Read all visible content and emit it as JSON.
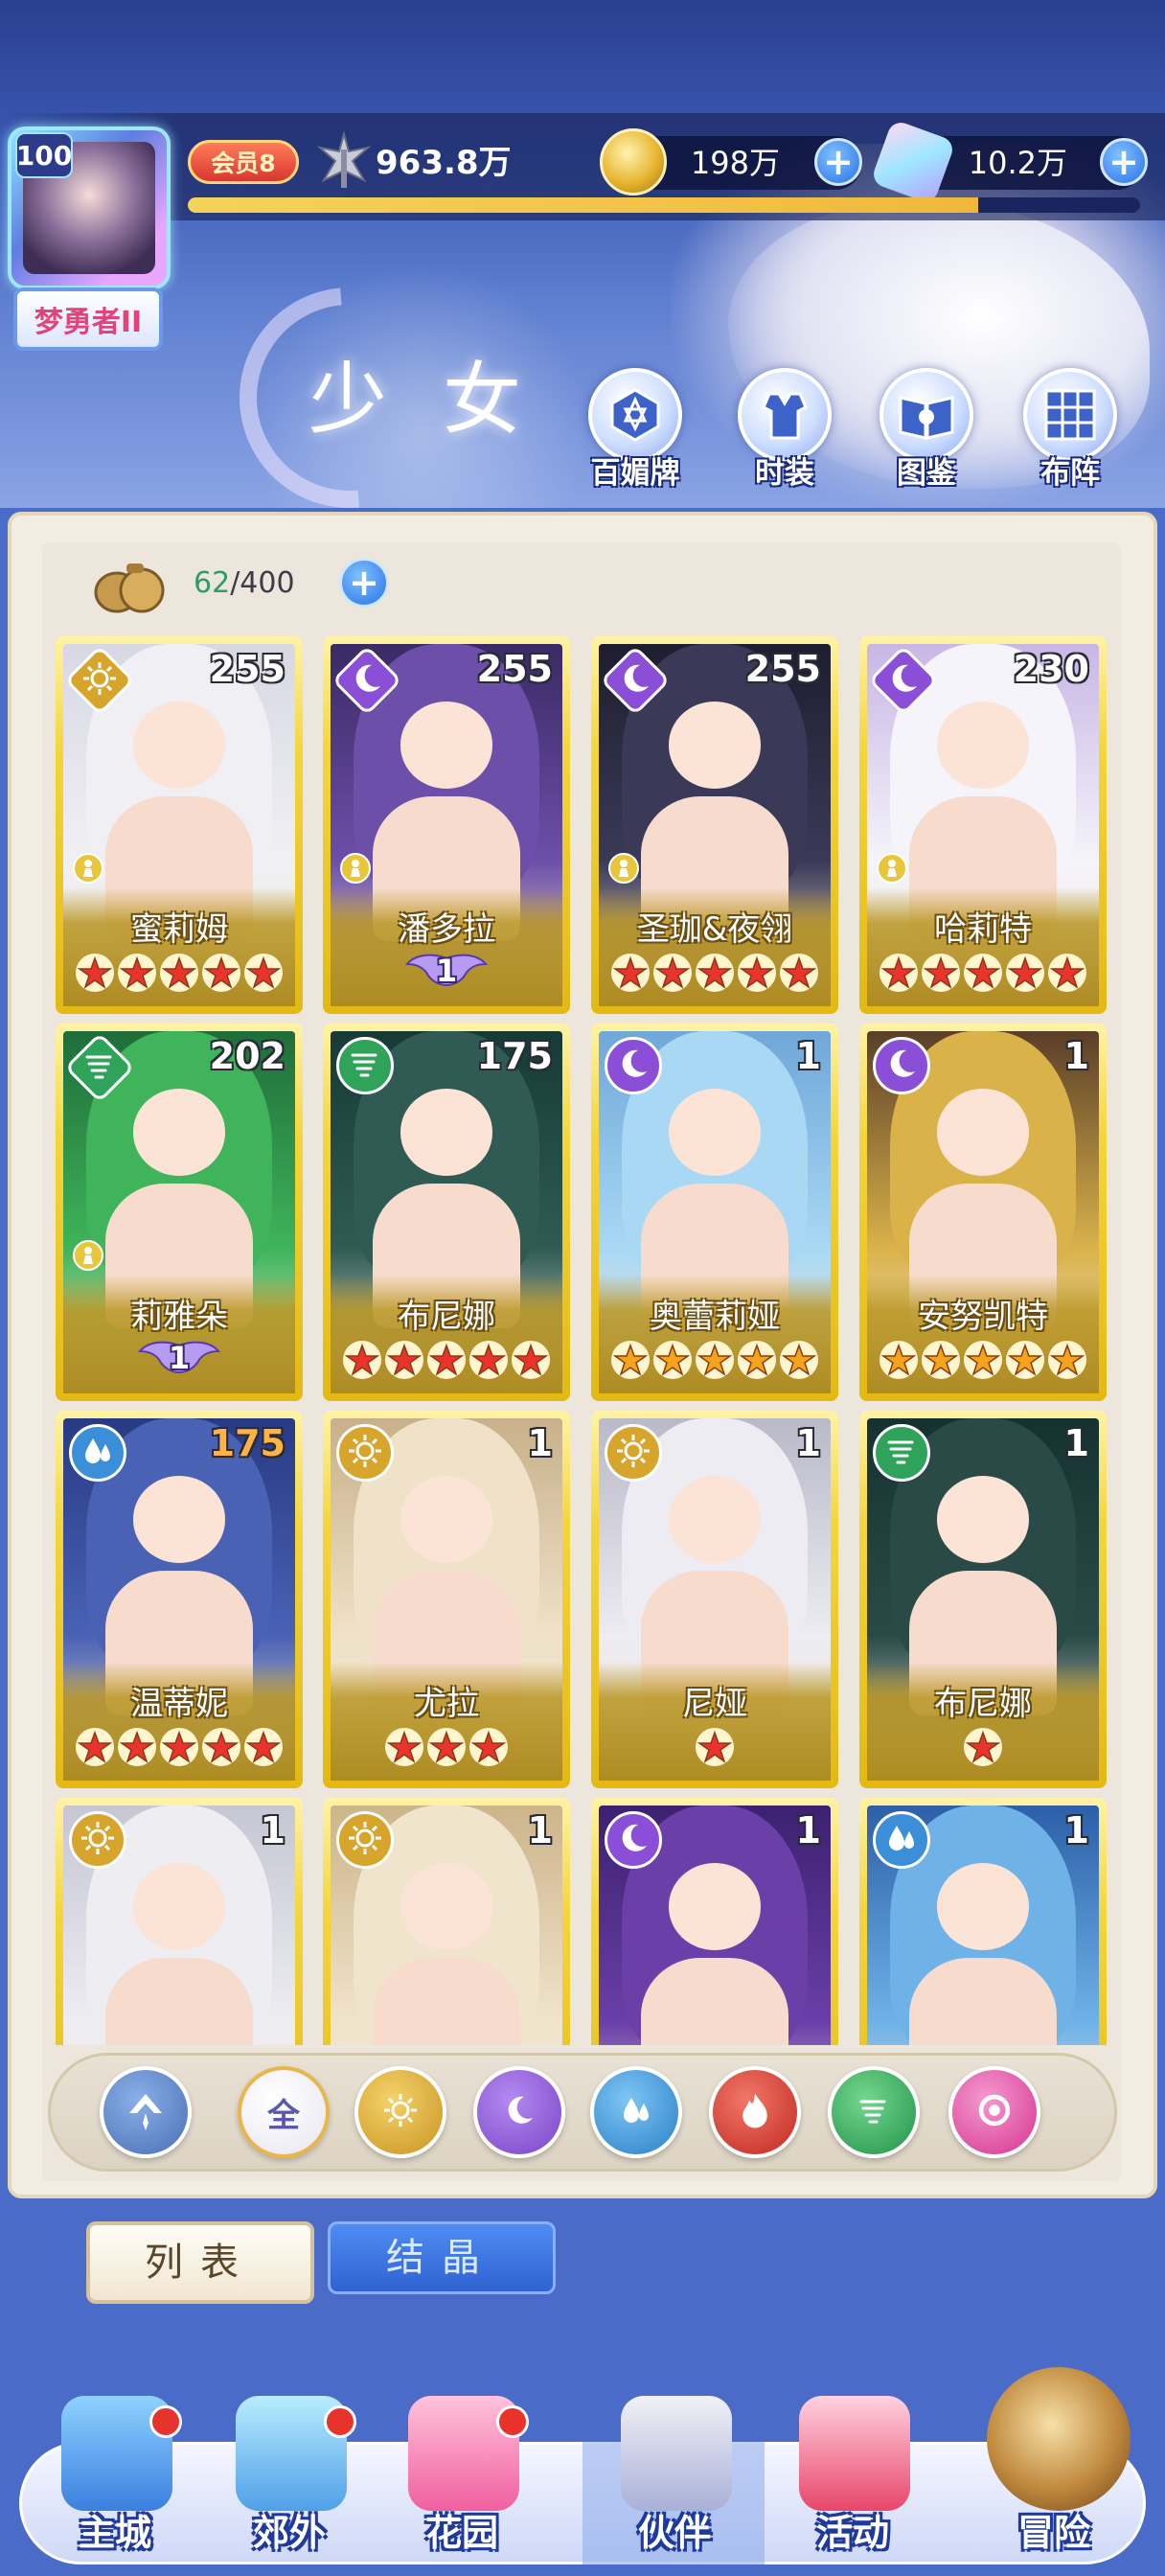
{
  "player": {
    "level": "100",
    "title": "梦勇者II",
    "vip": "会员8",
    "power": "963.8万",
    "exp_progress": 0.83
  },
  "currencies": {
    "gold": "198万",
    "gems": "10.2万"
  },
  "page": {
    "title": "少女"
  },
  "top_buttons": [
    {
      "label": "百媚牌",
      "icon": "card-hexagram-icon"
    },
    {
      "label": "时装",
      "icon": "outfit-icon"
    },
    {
      "label": "图鉴",
      "icon": "book-icon"
    },
    {
      "label": "布阵",
      "icon": "grid-formation-icon"
    }
  ],
  "inventory": {
    "current": "62",
    "max": "/400"
  },
  "cards": [
    {
      "name": "蜜莉姆",
      "level": "255",
      "element": "light",
      "stars": 5,
      "star_color": "red",
      "wing": ""
    },
    {
      "name": "潘多拉",
      "level": "255",
      "element": "dark",
      "stars": 0,
      "star_color": "red",
      "wing": "1"
    },
    {
      "name": "圣珈&夜翎",
      "level": "255",
      "element": "dark",
      "stars": 5,
      "star_color": "red",
      "wing": ""
    },
    {
      "name": "哈莉特",
      "level": "230",
      "element": "dark",
      "stars": 5,
      "star_color": "red",
      "wing": ""
    },
    {
      "name": "莉雅朵",
      "level": "202",
      "element": "wind",
      "stars": 0,
      "star_color": "red",
      "wing": "1"
    },
    {
      "name": "布尼娜",
      "level": "175",
      "element": "wind",
      "stars": 5,
      "star_color": "red",
      "wing": ""
    },
    {
      "name": "奥蕾莉娅",
      "level": "1",
      "element": "dark",
      "stars": 5,
      "star_color": "gold",
      "wing": ""
    },
    {
      "name": "安努凯特",
      "level": "1",
      "element": "dark",
      "stars": 5,
      "star_color": "gold",
      "wing": ""
    },
    {
      "name": "温蒂妮",
      "level": "175",
      "element": "water",
      "stars": 5,
      "star_color": "red",
      "wing": ""
    },
    {
      "name": "尤拉",
      "level": "1",
      "element": "light",
      "stars": 3,
      "star_color": "red",
      "wing": ""
    },
    {
      "name": "尼娅",
      "level": "1",
      "element": "light",
      "stars": 1,
      "star_color": "red",
      "wing": ""
    },
    {
      "name": "布尼娜",
      "level": "1",
      "element": "wind",
      "stars": 1,
      "star_color": "red",
      "wing": ""
    },
    {
      "name": "",
      "level": "1",
      "element": "light",
      "stars": 0,
      "star_color": "red",
      "wing": ""
    },
    {
      "name": "",
      "level": "1",
      "element": "light",
      "stars": 0,
      "star_color": "red",
      "wing": ""
    },
    {
      "name": "",
      "level": "1",
      "element": "dark",
      "stars": 0,
      "star_color": "red",
      "wing": ""
    },
    {
      "name": "",
      "level": "1",
      "element": "water",
      "stars": 0,
      "star_color": "red",
      "wing": ""
    }
  ],
  "filters": [
    {
      "name": "sort",
      "label": ""
    },
    {
      "name": "all",
      "label": "全"
    },
    {
      "name": "light",
      "label": ""
    },
    {
      "name": "dark",
      "label": ""
    },
    {
      "name": "water",
      "label": ""
    },
    {
      "name": "fire",
      "label": ""
    },
    {
      "name": "wind",
      "label": ""
    },
    {
      "name": "spirit",
      "label": ""
    }
  ],
  "tabs": {
    "list": "列表",
    "crystal": "结晶"
  },
  "nav": [
    {
      "label": "主城",
      "badge": true
    },
    {
      "label": "郊外",
      "badge": true
    },
    {
      "label": "花园",
      "badge": true
    },
    {
      "label": "伙伴",
      "badge": false
    },
    {
      "label": "活动",
      "badge": false
    },
    {
      "label": "冒险",
      "badge": false
    }
  ],
  "colors": {
    "light": "#d7a52c",
    "dark": "#8a4fd6",
    "water": "#3a8fd8",
    "wind": "#2fa35a",
    "fire": "#d23a2a",
    "spirit": "#e04fa6",
    "red_star": "#e8342c",
    "gold_star": "#f2a51c"
  }
}
